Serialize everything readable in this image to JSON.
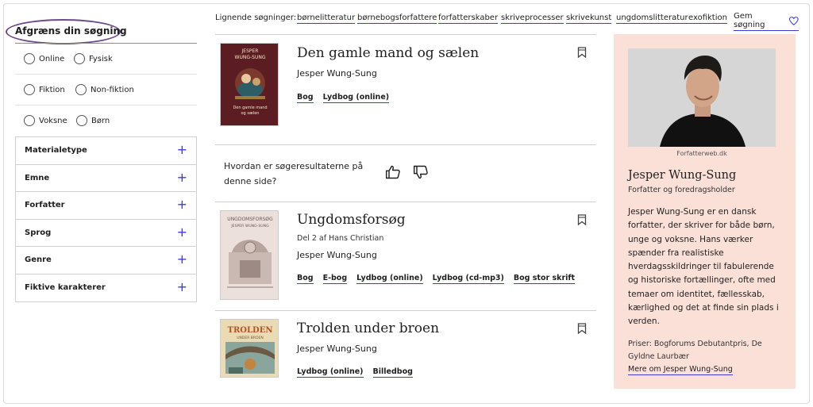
{
  "sidebar": {
    "title": "Afgræns din søgning",
    "radio_groups": [
      [
        "Online",
        "Fysisk"
      ],
      [
        "Fiktion",
        "Non-fiktion"
      ],
      [
        "Voksne",
        "Børn"
      ]
    ],
    "filters": [
      "Materialetype",
      "Emne",
      "Forfatter",
      "Sprog",
      "Genre",
      "Fiktive karakterer"
    ]
  },
  "related": {
    "label": "Lignende søgninger:",
    "links": [
      "børnelitteratur",
      "børnebogsforfattere",
      "forfatterskaber",
      "skriveprocesser",
      "skrivekunst",
      "ungdomslitteratur",
      "exofiktion"
    ],
    "save_label": "Gem søgning"
  },
  "results": [
    {
      "title": "Den gamle mand og sælen",
      "subtitle": "",
      "author": "Jesper Wung-Sung",
      "formats": [
        "Bog",
        "Lydbog (online)"
      ],
      "cover_text": [
        "JESPER",
        "WUNG-SUNG",
        "Den gamle mand",
        "og sælen"
      ]
    },
    {
      "title": "Ungdomsforsøg",
      "subtitle": "Del 2 af Hans Christian",
      "author": "Jesper Wung-Sung",
      "formats": [
        "Bog",
        "E-bog",
        "Lydbog (online)",
        "Lydbog (cd-mp3)",
        "Bog stor skrift"
      ],
      "cover_text": [
        "UNGDOMSFORSØG",
        "JESPER WUNG-SUNG"
      ]
    },
    {
      "title": "Trolden under broen",
      "subtitle": "",
      "author": "Jesper Wung-Sung",
      "formats": [
        "Lydbog (online)",
        "Billedbog"
      ],
      "cover_text": [
        "TROLDEN",
        "UNDER BROEN"
      ]
    }
  ],
  "feedback": {
    "question": "Hvordan er søgeresultaterne på denne side?"
  },
  "author_panel": {
    "photo_credit": "Forfatterweb.dk",
    "name": "Jesper Wung-Sung",
    "role": "Forfatter og foredragsholder",
    "bio": "Jesper Wung-Sung er en dansk forfatter, der skriver for både børn, unge og voksne. Hans værker spænder fra realistiske hverdagsskildringer til fabulerende og historiske fortællinger, ofte med temaer om identitet, fællesskab, kærlighed og det at finde sin plads i verden.",
    "awards": "Priser: Bogforums Debutantpris, De Gyldne Laurbær",
    "more_link": "Mere om Jesper Wung-Sung"
  },
  "colors": {
    "accent": "#3b3bd6",
    "highlight_ring": "#6b4a8c",
    "panel_bg": "#fbe0d8"
  }
}
